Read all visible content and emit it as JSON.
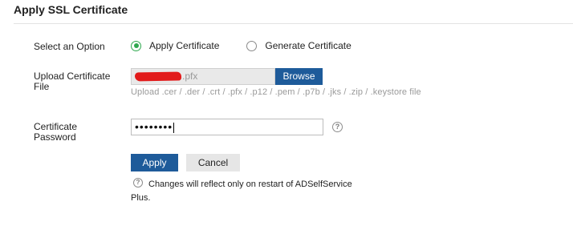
{
  "page": {
    "title": "Apply SSL Certificate"
  },
  "option": {
    "label": "Select an Option",
    "choices": [
      {
        "label": "Apply Certificate",
        "selected": true
      },
      {
        "label": "Generate Certificate",
        "selected": false
      }
    ]
  },
  "upload": {
    "label_line1": "Upload Certificate",
    "label_line2": "File",
    "file_ext": ".pfx",
    "browse_label": "Browse",
    "hint": "Upload .cer / .der / .crt / .pfx / .p12 / .pem / .p7b / .jks / .zip / .keystore file"
  },
  "password": {
    "label_line1": "Certificate",
    "label_line2": "Password",
    "masked_value": "••••••••",
    "help_glyph": "?"
  },
  "actions": {
    "apply_label": "Apply",
    "cancel_label": "Cancel"
  },
  "note": {
    "icon_glyph": "?",
    "text": "Changes will reflect only on restart of ADSelfService Plus."
  },
  "colors": {
    "accent": "#1e5b9a",
    "radio_selected": "#2fa84f",
    "redaction": "#e21b1b"
  },
  "icons": {
    "help": "question-circle-icon",
    "note": "info-question-icon"
  }
}
